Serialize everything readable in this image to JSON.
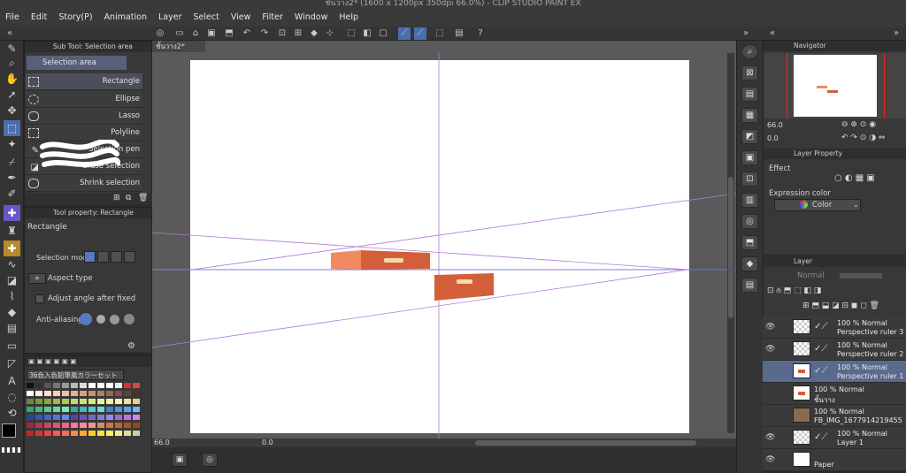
{
  "window": {
    "title": "ชั้นวาง2* (1600 x 1200px 350dpi 66.0%) - CLIP STUDIO PAINT EX"
  },
  "menu": [
    "File",
    "Edit",
    "Story(P)",
    "Animation",
    "Layer",
    "Select",
    "View",
    "Filter",
    "Window",
    "Help"
  ],
  "subtool_panel": {
    "title": "Sub Tool: Selection area",
    "group": "Selection area",
    "items": [
      "Rectangle",
      "Ellipse",
      "Lasso",
      "Polyline",
      "Selection pen",
      "Erase selection",
      "Shrink selection"
    ],
    "selected_index": 0
  },
  "tool_property": {
    "title": "Tool property: Rectangle",
    "name": "Rectangle",
    "selection_mode_label": "Selection mode",
    "aspect_type_label": "Aspect type",
    "adjust_angle_label": "Adjust angle after fixed",
    "anti_aliasing_label": "Anti-aliasing"
  },
  "color_set": {
    "name": "36色入色鉛筆風カラーセット",
    "swatches": [
      "#111111",
      "#333333",
      "#555555",
      "#777777",
      "#999999",
      "#bbbbbb",
      "#dddddd",
      "#ffffff",
      "#ffffff",
      "#ffffff",
      "#eeeeee",
      "#cc3333",
      "#dd4444",
      "#ffffff",
      "#ffeedd",
      "#ffe0cc",
      "#f8d0b8",
      "#f0c0a0",
      "#e8b090",
      "#d8a080",
      "#c89070",
      "#b08060",
      "#986850",
      "#805040",
      "#684030",
      "#503020",
      "#6a8a3a",
      "#7a9a3a",
      "#8aaa3a",
      "#9aba4a",
      "#aaca5a",
      "#bada6a",
      "#cae07a",
      "#d8e88a",
      "#e8f09a",
      "#f0f0aa",
      "#f8f0ba",
      "#f0e0a0",
      "#e8d090",
      "#33aa66",
      "#44bb77",
      "#55cc88",
      "#66dd99",
      "#77eeaa",
      "#33aaaa",
      "#44bbbb",
      "#55cccc",
      "#66dddd",
      "#3388cc",
      "#4499dd",
      "#55aaee",
      "#66bbff",
      "#2244aa",
      "#3355bb",
      "#4466cc",
      "#5577dd",
      "#6688ee",
      "#5544aa",
      "#6655bb",
      "#7766cc",
      "#8877dd",
      "#9988ee",
      "#aa66cc",
      "#bb77dd",
      "#cc88ee",
      "#aa2244",
      "#bb3355",
      "#cc4466",
      "#dd5577",
      "#ee6688",
      "#ff7799",
      "#ff88aa",
      "#ee9988",
      "#dd8866",
      "#cc7744",
      "#bb6633",
      "#aa5522",
      "#994411",
      "#cc2222",
      "#dd3333",
      "#ee4444",
      "#ff5555",
      "#ff6666",
      "#ff8844",
      "#ffaa33",
      "#ffcc22",
      "#ffdd44",
      "#ffee66",
      "#eeee88",
      "#dddd99",
      "#ccccaa"
    ]
  },
  "document": {
    "tab_name": "ชั้นวาง2*",
    "zoom": "66.0",
    "angle": "0.0",
    "shelves": {
      "front_color": "#d35f3a",
      "top_color": "#f08a60",
      "handle_color": "#f5d9a8"
    }
  },
  "navigator": {
    "title": "Navigator",
    "zoom": "66.0",
    "angle": "0.0"
  },
  "layer_property": {
    "title": "Layer Property",
    "effect_label": "Effect",
    "expression_color_label": "Expression color",
    "expression_color_value": "Color"
  },
  "layer_panel": {
    "title": "Layer",
    "blend_mode": "Normal",
    "layers": [
      {
        "line1": "100 % Normal",
        "line2": "Perspective ruler 3",
        "thumb": "checker",
        "selected": false,
        "visible": true
      },
      {
        "line1": "100 % Normal",
        "line2": "Perspective ruler 2",
        "thumb": "checker",
        "selected": false,
        "visible": true
      },
      {
        "line1": "100 % Normal",
        "line2": "Perspective ruler 1",
        "thumb": "shelf",
        "selected": true,
        "visible": false
      },
      {
        "line1": "100 % Normal",
        "line2": "ชั้นวาง",
        "thumb": "shelf-small",
        "selected": false,
        "visible": false
      },
      {
        "line1": "100 % Normal",
        "line2": "FB_IMG_1677914219455",
        "thumb": "photo",
        "selected": false,
        "visible": false
      },
      {
        "line1": "100 % Normal",
        "line2": "Layer 1",
        "thumb": "checker",
        "selected": false,
        "visible": true
      },
      {
        "line1": "",
        "line2": "Paper",
        "thumb": "white",
        "selected": false,
        "visible": true
      }
    ]
  },
  "colors": {
    "accent": "#4b6eaf",
    "canvas_bg": "#5a5a5a",
    "ruler_line": "#b27ad6",
    "horizon_line": "#5a78d8"
  }
}
